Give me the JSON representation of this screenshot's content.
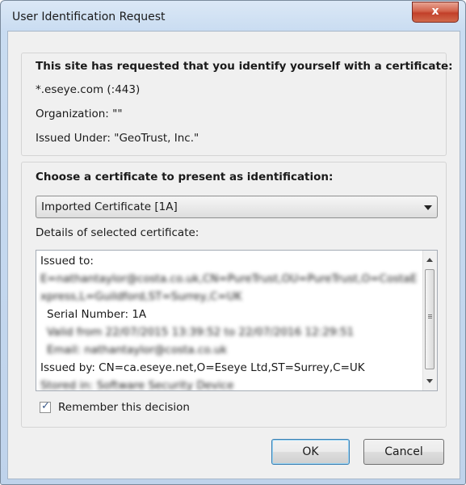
{
  "window": {
    "title": "User Identification Request",
    "close_glyph": "x"
  },
  "request": {
    "heading": "This site has requested that you identify yourself with a certificate:",
    "host": "*.eseye.com (:443)",
    "organization": "Organization: \"\"",
    "issued_under": "Issued Under: \"GeoTrust, Inc.\""
  },
  "choose": {
    "heading": "Choose a certificate to present as identification:",
    "selected": "Imported Certificate [1A]",
    "details_label": "Details of selected certificate:"
  },
  "details": {
    "lines": [
      "Issued to:",
      "E=nathantaylor@costa.co.uk,CN=PureTrust,OU=PureTrust,O=CostaE",
      "xpress,L=Guildford,ST=Surrey,C=UK",
      "Serial Number: 1A",
      "Valid from 22/07/2015 13:39:52 to 22/07/2016 12:29:51",
      "Email: nathantaylor@costa.co.uk",
      "Issued by: CN=ca.eseye.net,O=Eseye Ltd,ST=Surrey,C=UK",
      "Stored in: Software Security Device"
    ]
  },
  "remember": {
    "label": "Remember this decision",
    "checked": true
  },
  "buttons": {
    "ok": "OK",
    "cancel": "Cancel"
  }
}
